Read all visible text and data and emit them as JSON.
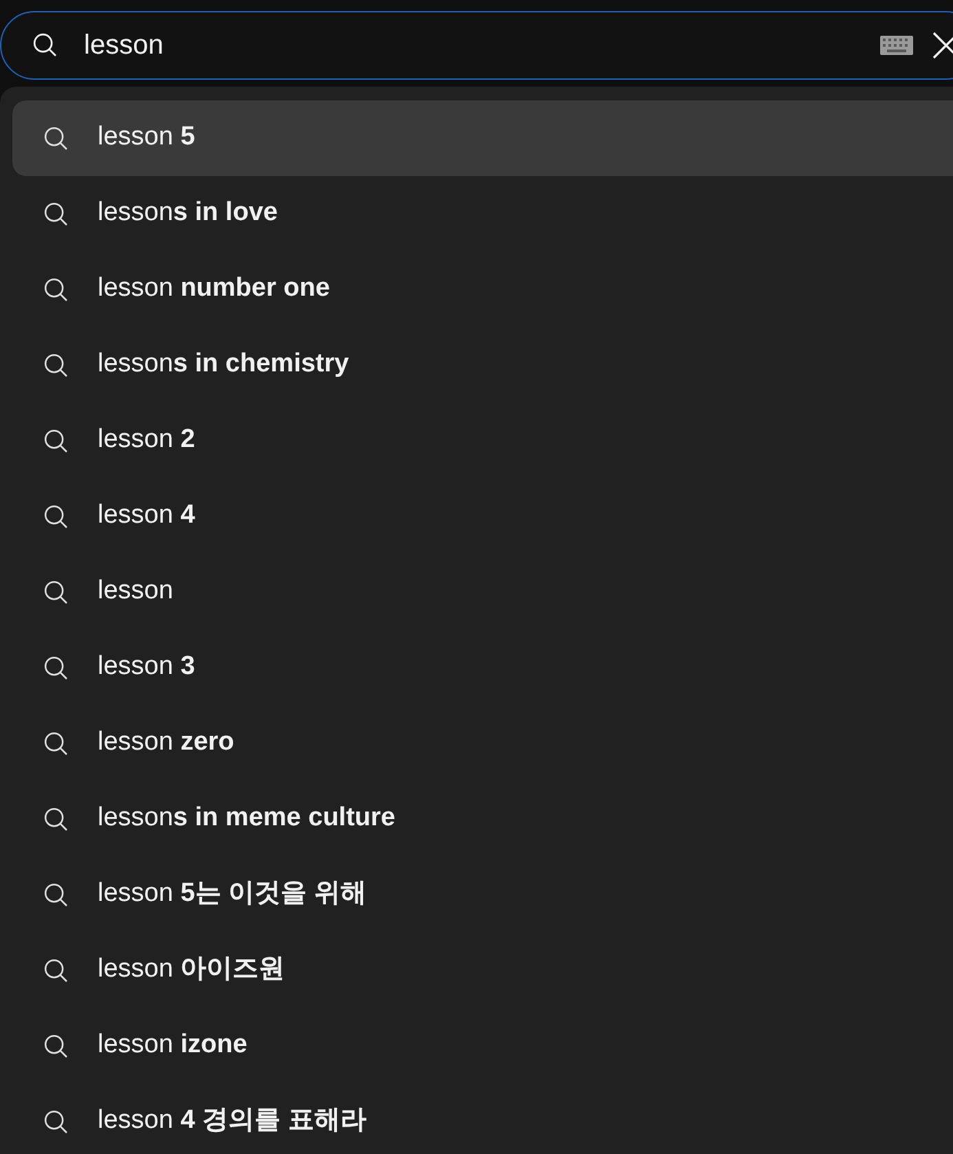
{
  "search": {
    "value": "lesson"
  },
  "suggestions": [
    {
      "text": "lesson **5**",
      "selected": true
    },
    {
      "text": "lesson**s in love**",
      "selected": false
    },
    {
      "text": "lesson **number one**",
      "selected": false
    },
    {
      "text": "lesson**s in chemistry**",
      "selected": false
    },
    {
      "text": "lesson **2**",
      "selected": false
    },
    {
      "text": "lesson **4**",
      "selected": false
    },
    {
      "text": "lesson",
      "selected": false
    },
    {
      "text": "lesson **3**",
      "selected": false
    },
    {
      "text": "lesson **zero**",
      "selected": false
    },
    {
      "text": "lesson**s in meme culture**",
      "selected": false
    },
    {
      "text": "lesson **5는 이것을 위해**",
      "selected": false
    },
    {
      "text": "lesson **아이즈원**",
      "selected": false
    },
    {
      "text": "lesson **izone**",
      "selected": false
    },
    {
      "text": "lesson **4 경의를 표해라**",
      "selected": false
    }
  ]
}
